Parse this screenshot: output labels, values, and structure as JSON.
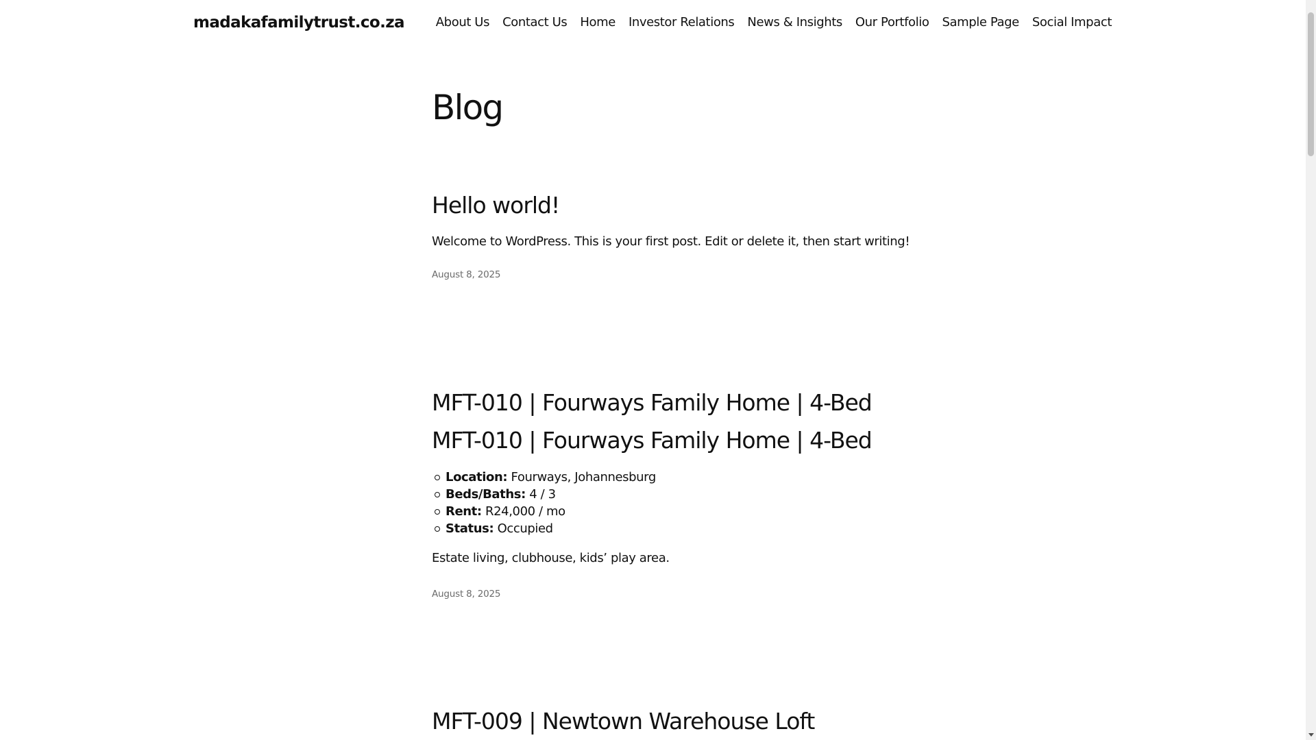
{
  "header": {
    "site_title": "madakafamilytrust.co.za",
    "nav": [
      {
        "label": "About Us"
      },
      {
        "label": "Contact Us"
      },
      {
        "label": "Home"
      },
      {
        "label": "Investor Relations"
      },
      {
        "label": "News & Insights"
      },
      {
        "label": "Our Portfolio"
      },
      {
        "label": "Sample Page"
      },
      {
        "label": "Social Impact"
      }
    ]
  },
  "main": {
    "heading": "Blog",
    "posts": [
      {
        "title": "Hello world!",
        "excerpt": "Welcome to WordPress. This is your first post. Edit or delete it, then start writing!",
        "date": "August 8, 2025"
      },
      {
        "title": "MFT-010 | Fourways Family Home | 4-Bed",
        "content_heading": "MFT-010 | Fourways Family Home | 4-Bed",
        "details": [
          {
            "key": "Location:",
            "value": " Fourways, Johannesburg"
          },
          {
            "key": "Beds/Baths:",
            "value": " 4 / 3"
          },
          {
            "key": "Rent:",
            "value": " R24,000 / mo"
          },
          {
            "key": "Status:",
            "value": " Occupied"
          }
        ],
        "excerpt": "Estate living, clubhouse, kids’ play area.",
        "date": "August 8, 2025"
      },
      {
        "title": "MFT-009 | Newtown Warehouse Loft"
      }
    ]
  }
}
